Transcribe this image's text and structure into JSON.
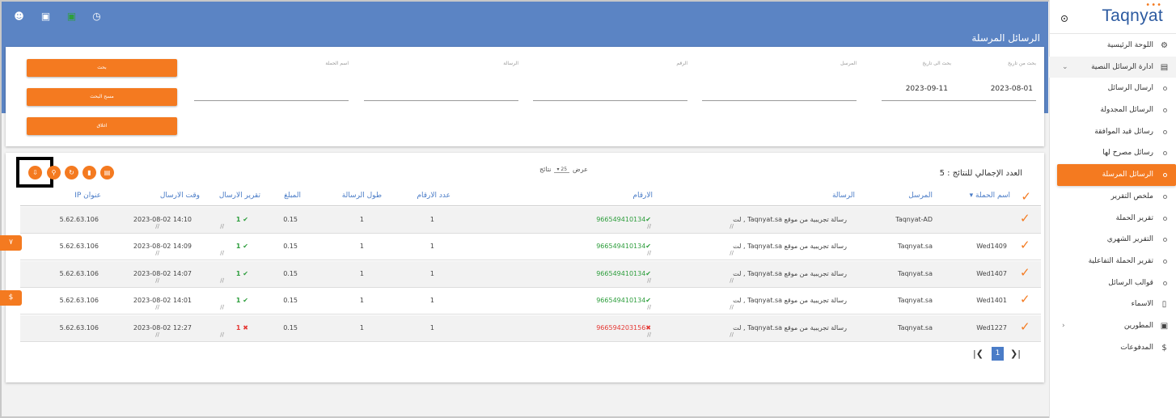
{
  "brand": {
    "name": "Taqnyat",
    "dots": "•••",
    "accent": "#f47a20",
    "primary": "#5b84c4"
  },
  "header": {
    "title": "الرسائل المرسلة",
    "icons": [
      "user-circle-icon",
      "image-icon",
      "flag-icon",
      "clock-icon"
    ]
  },
  "sidebar": {
    "items": [
      {
        "label": "اللوحة الرئيسية",
        "icon": "dashboard-icon"
      },
      {
        "label": "ادارة الرسائل النصية",
        "icon": "message-icon",
        "expanded": true
      },
      {
        "label": "ارسال الرسائل"
      },
      {
        "label": "الرسائل المجدولة"
      },
      {
        "label": "رسائل قيد الموافقة"
      },
      {
        "label": "رسائل مصرح لها"
      },
      {
        "label": "الرسائل المرسلة",
        "active": true
      },
      {
        "label": "ملخص التقرير"
      },
      {
        "label": "تقرير الحملة"
      },
      {
        "label": "التقرير الشهري"
      },
      {
        "label": "تقرير الحملة التفاعلية"
      },
      {
        "label": "قوالب الرسائل"
      },
      {
        "label": "الاسماء",
        "icon": "book-icon"
      },
      {
        "label": "المطورين",
        "icon": "code-icon"
      },
      {
        "label": "المدفوعات",
        "icon": "dollar-icon"
      }
    ]
  },
  "search": {
    "fields": [
      {
        "label": "بحث من تاريخ",
        "value": "2023-08-01"
      },
      {
        "label": "بحث الى تاريخ",
        "value": "2023-09-11"
      },
      {
        "label": "المرسل",
        "value": ""
      },
      {
        "label": "الرقم",
        "value": ""
      },
      {
        "label": "الرسالة",
        "value": ""
      },
      {
        "label": "اسم الحملة",
        "value": ""
      }
    ],
    "buttons": {
      "search": "بحث",
      "clear": "مسح البحث",
      "close": "اغلاق"
    }
  },
  "results": {
    "total_label": "العدد الإجمالي للنتائج : 5",
    "show_label": "عرض",
    "per_page": "25",
    "results_label": "نتائج",
    "columns": [
      "اسم الحملة",
      "المرسل",
      "الرسالة",
      "الارقام",
      "عدد الارقام",
      "طول الرسالة",
      "المبلغ",
      "تقرير الارسال",
      "وقت الارسال",
      "عنوان IP"
    ],
    "rows": [
      {
        "campaign": "",
        "sender": "Taqnyat-AD",
        "message": "رسالة تجريبية من موقع Taqnyat.sa , لت",
        "number": "966549410134",
        "status": "ok",
        "count": "1",
        "length": "1",
        "amount": "0.15",
        "report": "1",
        "time": "2023-08-02 14:10",
        "ip": "5.62.63.106"
      },
      {
        "campaign": "Wed1409",
        "sender": "Taqnyat.sa",
        "message": "رسالة تجريبية من موقع Taqnyat.sa , لت",
        "number": "966549410134",
        "status": "ok",
        "count": "1",
        "length": "1",
        "amount": "0.15",
        "report": "1",
        "time": "2023-08-02 14:09",
        "ip": "5.62.63.106"
      },
      {
        "campaign": "Wed1407",
        "sender": "Taqnyat.sa",
        "message": "رسالة تجريبية من موقع Taqnyat.sa , لت",
        "number": "966549410134",
        "status": "ok",
        "count": "1",
        "length": "1",
        "amount": "0.15",
        "report": "1",
        "time": "2023-08-02 14:07",
        "ip": "5.62.63.106"
      },
      {
        "campaign": "Wed1401",
        "sender": "Taqnyat.sa",
        "message": "رسالة تجريبية من موقع Taqnyat.sa , لت",
        "number": "966549410134",
        "status": "ok",
        "count": "1",
        "length": "1",
        "amount": "0.15",
        "report": "1",
        "time": "2023-08-02 14:01",
        "ip": "5.62.63.106"
      },
      {
        "campaign": "Wed1227",
        "sender": "Taqnyat.sa",
        "message": "رسالة تجريبية من موقع Taqnyat.sa , لت",
        "number": "966594203156",
        "status": "bad",
        "count": "1",
        "length": "1",
        "amount": "0.15",
        "report": "1",
        "time": "2023-08-02 12:27",
        "ip": "5.62.63.106"
      }
    ],
    "pagination": {
      "current": "1"
    }
  },
  "floating_tabs": [
    "٧",
    "$"
  ]
}
